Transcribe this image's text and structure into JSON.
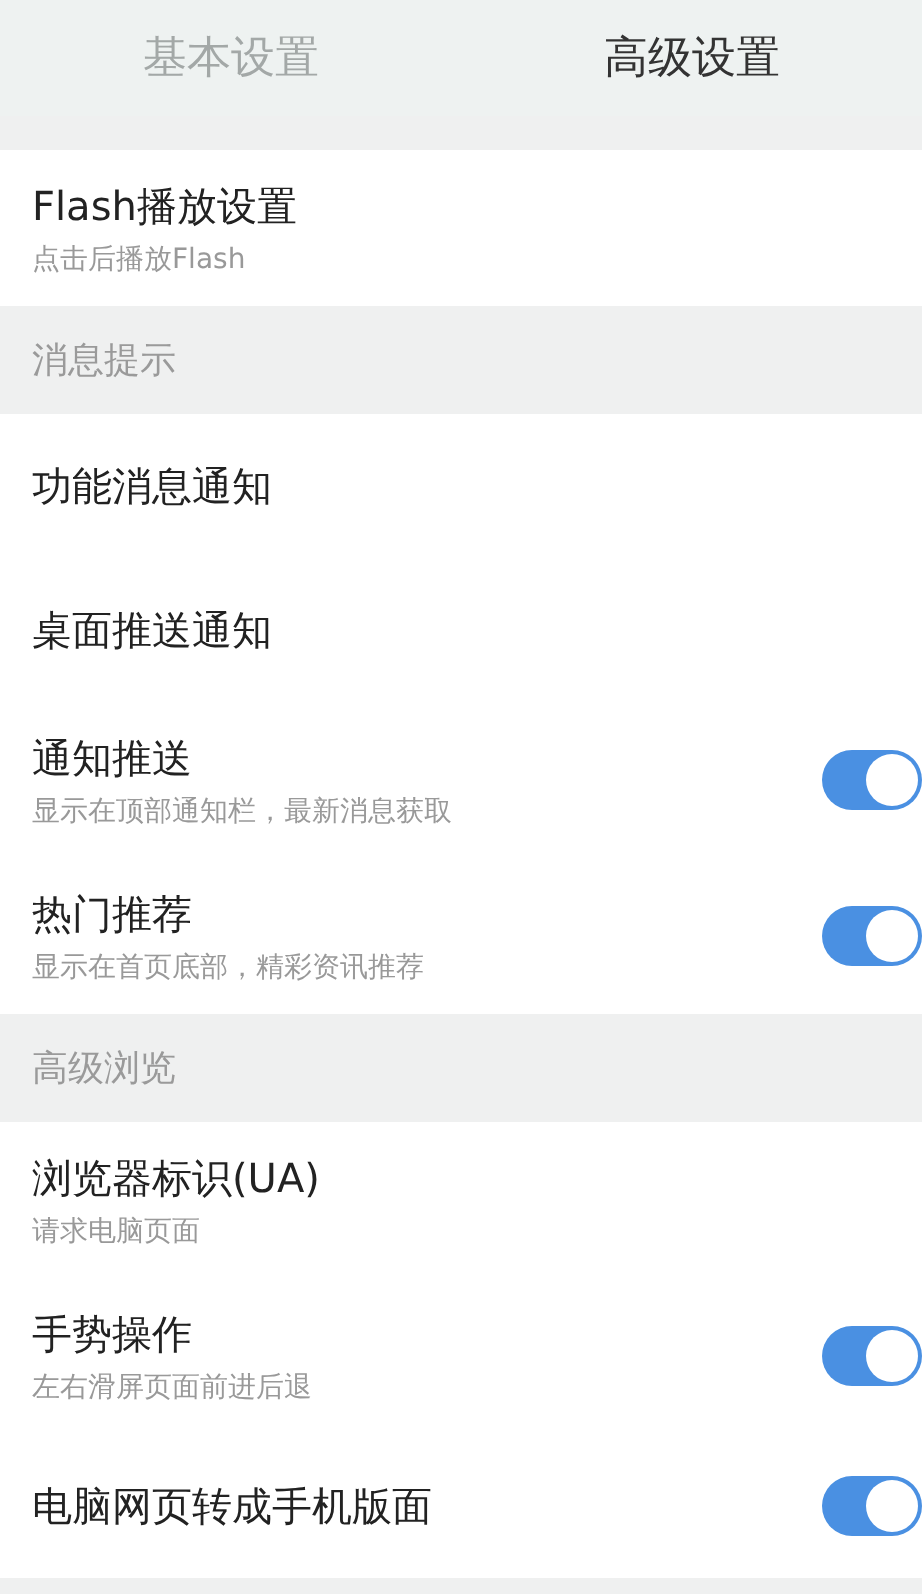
{
  "tabs": [
    {
      "label": "基本设置",
      "selected": false
    },
    {
      "label": "高级设置",
      "selected": true
    }
  ],
  "sections": [
    {
      "rows": [
        {
          "title": "Flash播放设置",
          "subtitle": "点击后播放Flash",
          "kind": "plain"
        }
      ]
    },
    {
      "header": "消息提示",
      "rows": [
        {
          "title": "功能消息通知",
          "kind": "plain"
        },
        {
          "title": "桌面推送通知",
          "kind": "plain"
        },
        {
          "title": "通知推送",
          "subtitle": "显示在顶部通知栏，最新消息获取",
          "kind": "toggle",
          "on": true
        },
        {
          "title": "热门推荐",
          "subtitle": "显示在首页底部，精彩资讯推荐",
          "kind": "toggle",
          "on": true
        }
      ]
    },
    {
      "header": "高级浏览",
      "rows": [
        {
          "title": "浏览器标识(UA)",
          "subtitle": "请求电脑页面",
          "kind": "plain"
        },
        {
          "title": "手势操作",
          "subtitle": "左右滑屏页面前进后退",
          "kind": "toggle",
          "on": true
        },
        {
          "title": "电脑网页转成手机版面",
          "kind": "toggle",
          "on": true
        }
      ]
    }
  ]
}
